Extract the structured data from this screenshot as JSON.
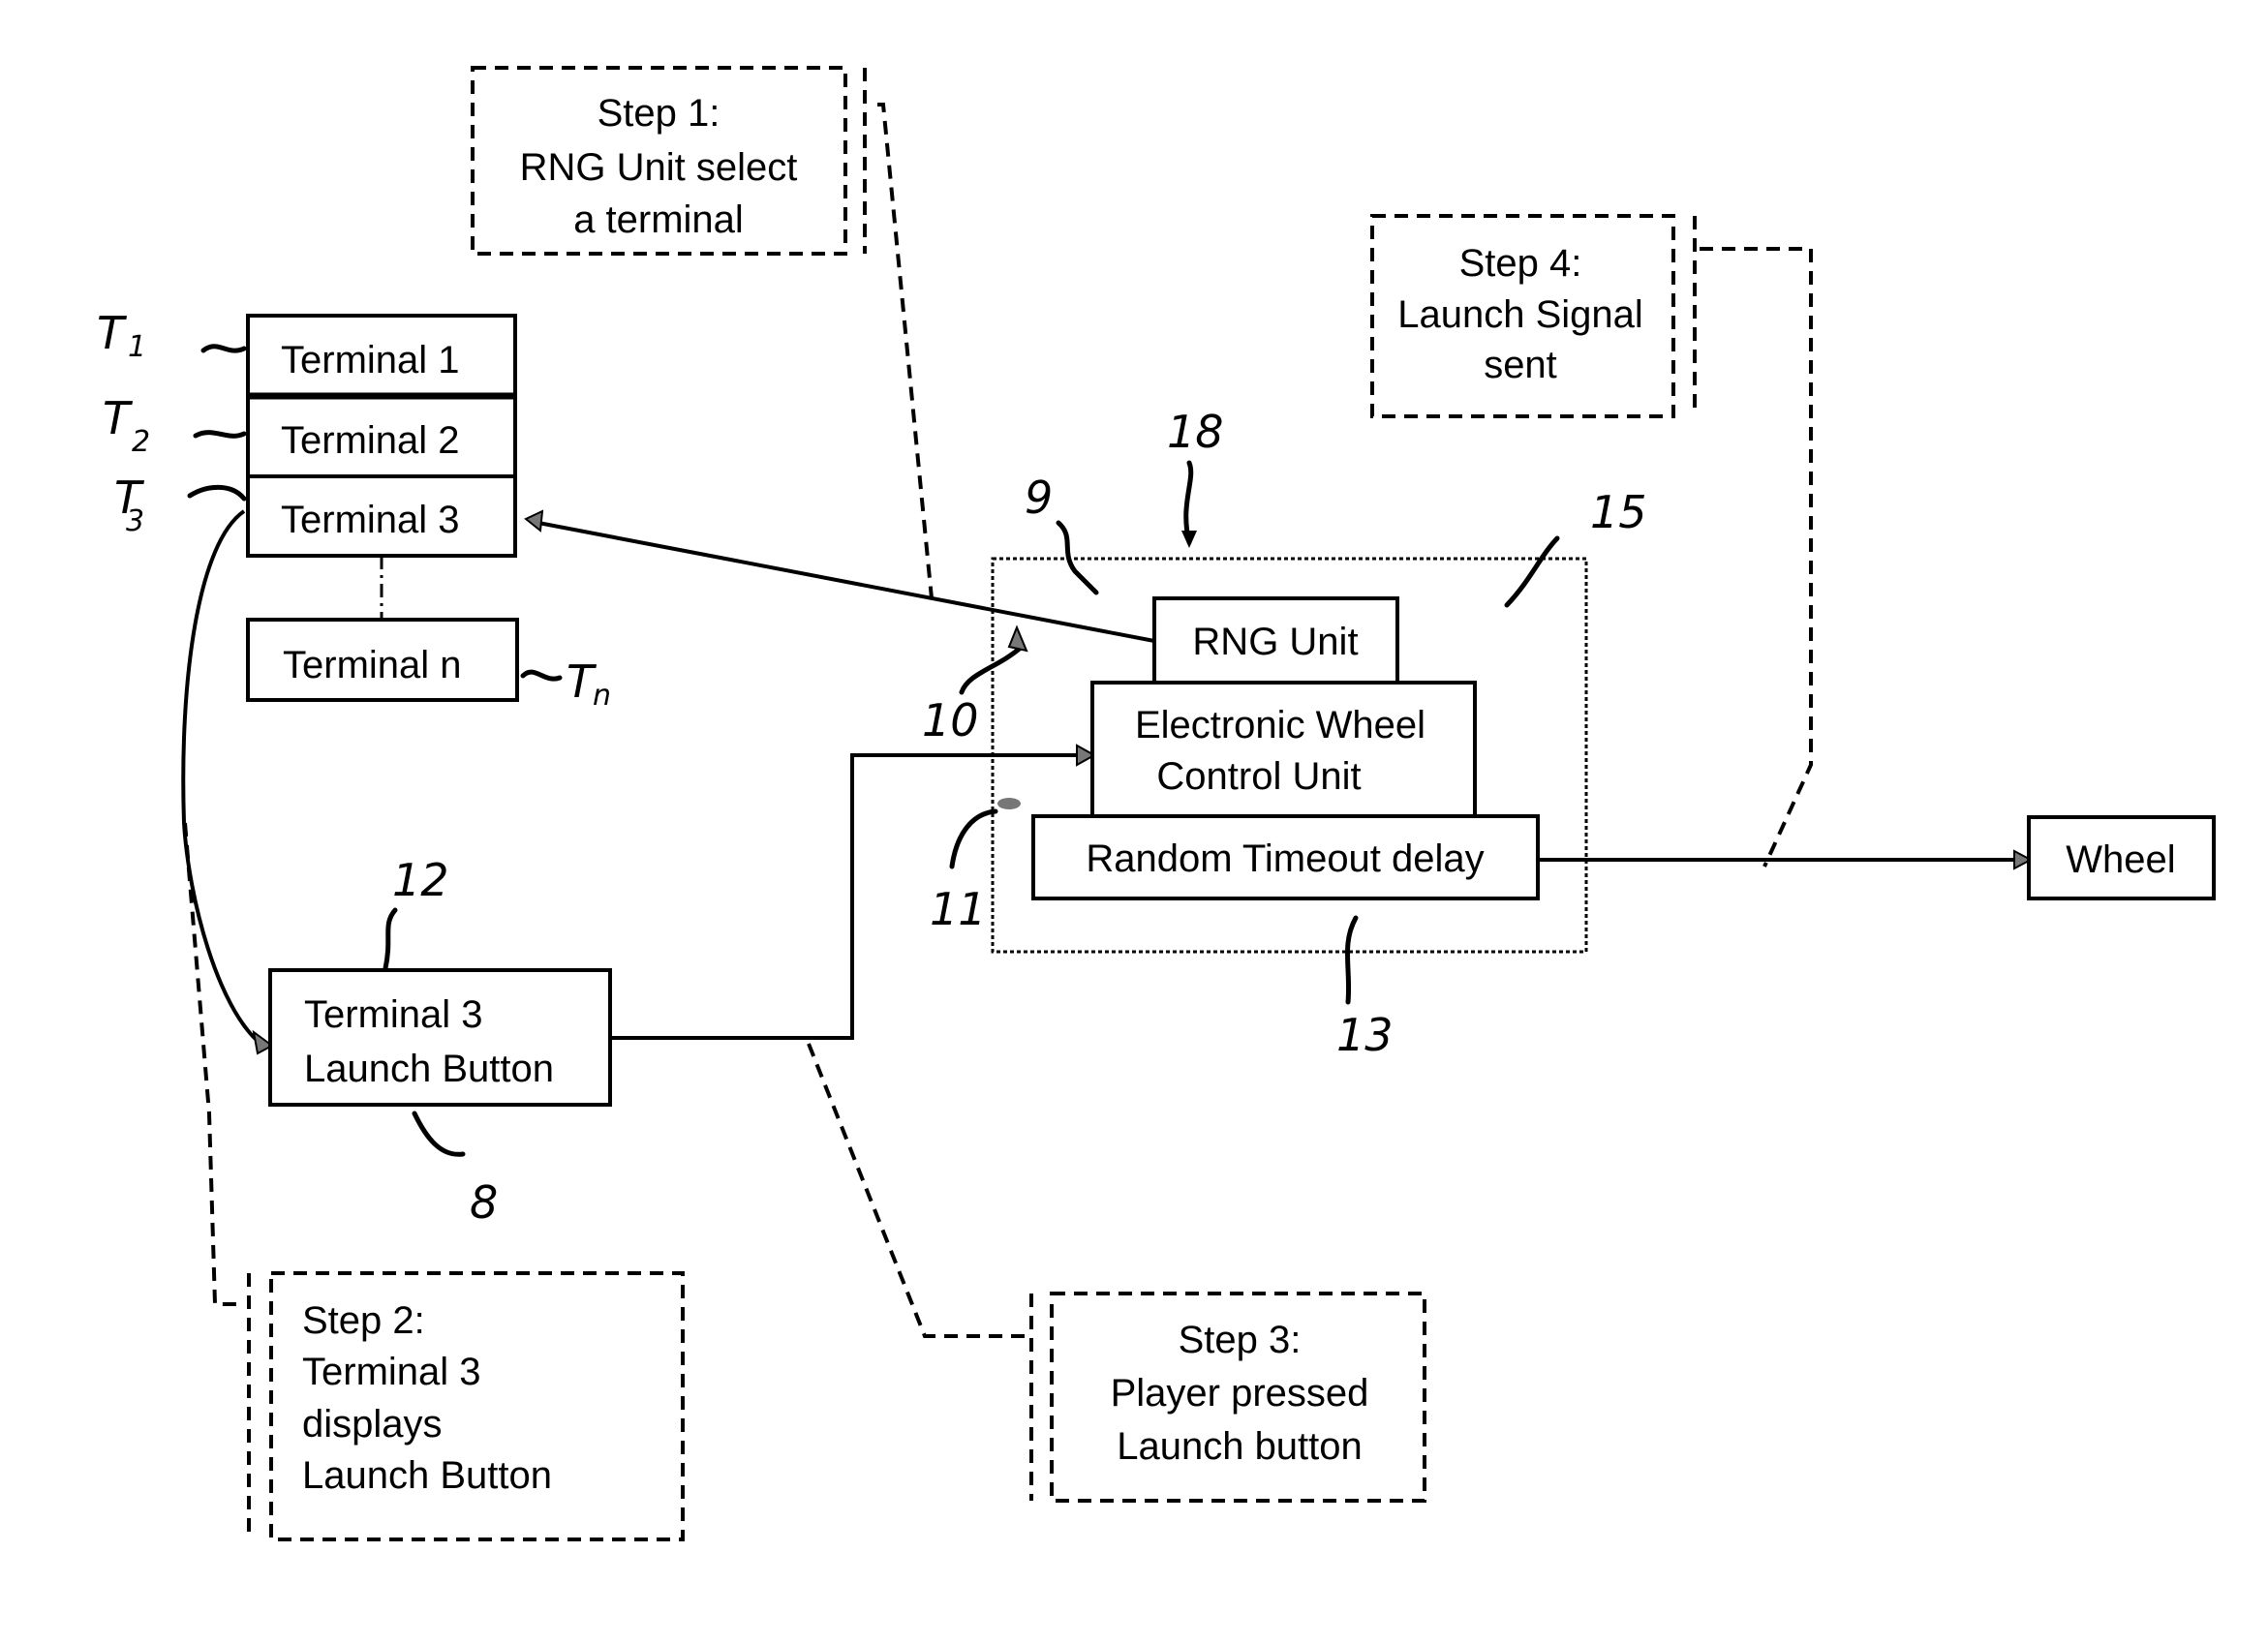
{
  "diagram": {
    "steps": [
      {
        "id": "step1",
        "lines": [
          "Step 1:",
          "RNG Unit select",
          "a terminal"
        ]
      },
      {
        "id": "step2",
        "lines": [
          "Step 2:",
          "Terminal 3",
          "displays",
          "Launch Button"
        ]
      },
      {
        "id": "step3",
        "lines": [
          "Step 3:",
          "Player pressed",
          "Launch button"
        ]
      },
      {
        "id": "step4",
        "lines": [
          "Step 4:",
          "Launch Signal",
          "sent"
        ]
      }
    ],
    "terminals": [
      {
        "label": "Terminal 1",
        "ref": "T",
        "ref_sub": "1"
      },
      {
        "label": "Terminal 2",
        "ref": "T",
        "ref_sub": "2"
      },
      {
        "label": "Terminal 3",
        "ref": "T",
        "ref_sub": "3"
      },
      {
        "label": "Terminal n",
        "ref": "T",
        "ref_sub": "n"
      }
    ],
    "launch_button": {
      "lines": [
        "Terminal 3",
        "Launch Button"
      ]
    },
    "control_group": {
      "rng_unit": "RNG Unit",
      "ewcu": [
        "Electronic Wheel",
        "Control Unit"
      ],
      "random_timeout": "Random Timeout delay"
    },
    "wheel": "Wheel",
    "reference_numerals": {
      "controller": "18",
      "enclosure": "15",
      "rng": "9",
      "rng_link": "10",
      "ewcu": "11",
      "launch_button": "12",
      "timeout": "13",
      "button_signal": "8"
    }
  }
}
